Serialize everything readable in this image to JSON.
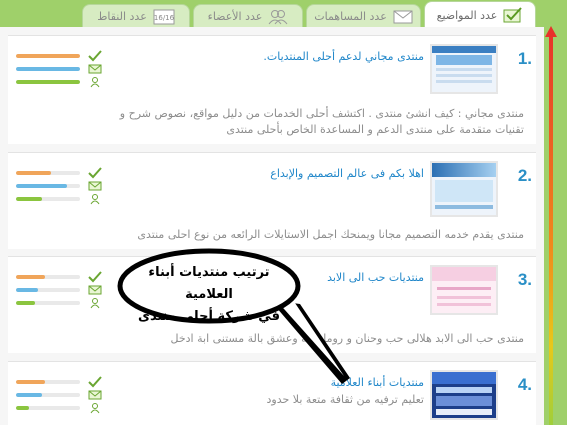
{
  "tabs": [
    {
      "label": "عدد المواضيع",
      "icon": "topics-icon",
      "active": true
    },
    {
      "label": "عدد المساهمات",
      "icon": "envelope-icon",
      "active": false
    },
    {
      "label": "عدد الأعضاء",
      "icon": "members-icon",
      "active": false
    },
    {
      "label": "عدد النقاط",
      "icon": "points-icon",
      "active": false
    }
  ],
  "points_icon_text": "16/16",
  "entries": [
    {
      "rank": "1.",
      "title": "منتدى مجاني لدعم أحلى المنتديات.",
      "description": "منتدى مجاني : كيف انشئ منتدى . اكتشف أحلى الخدمات من دليل مواقع، نصوص شرح و تقنيات متقدمة على منتدى الدعم و المساعدة الخاص بأحلى منتدى",
      "topics_fill": 1.0,
      "posts_fill": 1.0,
      "members_fill": 1.0
    },
    {
      "rank": "2.",
      "title": "اهلا بكم فى عالم التصميم والإبداع",
      "description": "منتدى يقدم خدمه التصميم مجانا ويمنحك اجمل الاستايلات الرائعه من نوع احلى منتدى",
      "topics_fill": 0.55,
      "posts_fill": 0.8,
      "members_fill": 0.4
    },
    {
      "rank": "3.",
      "title": "منتديات حب الى الابد",
      "description": "منتدى حب الى الابد هلالى حب وحنان و رومانسيه وعشق بالة مستنى ابة ادخل",
      "topics_fill": 0.45,
      "posts_fill": 0.35,
      "members_fill": 0.3
    },
    {
      "rank": "4.",
      "title": "منتديات أبناء العلامية",
      "description": "تعليم ترفيه من ثقافة متعة بلا حدود",
      "topics_fill": 0.45,
      "posts_fill": 0.4,
      "members_fill": 0.2
    }
  ],
  "bubble": {
    "line1": "ترتيب منتديات أبناء العلامية",
    "line2": "في شركة أحلى منتدى"
  },
  "colors": {
    "topics_bar": "#f0a55a",
    "posts_bar": "#69b8e4",
    "members_bar": "#8bc53f",
    "accent_blue": "#1f86c9",
    "background_green": "#9fd06a"
  }
}
